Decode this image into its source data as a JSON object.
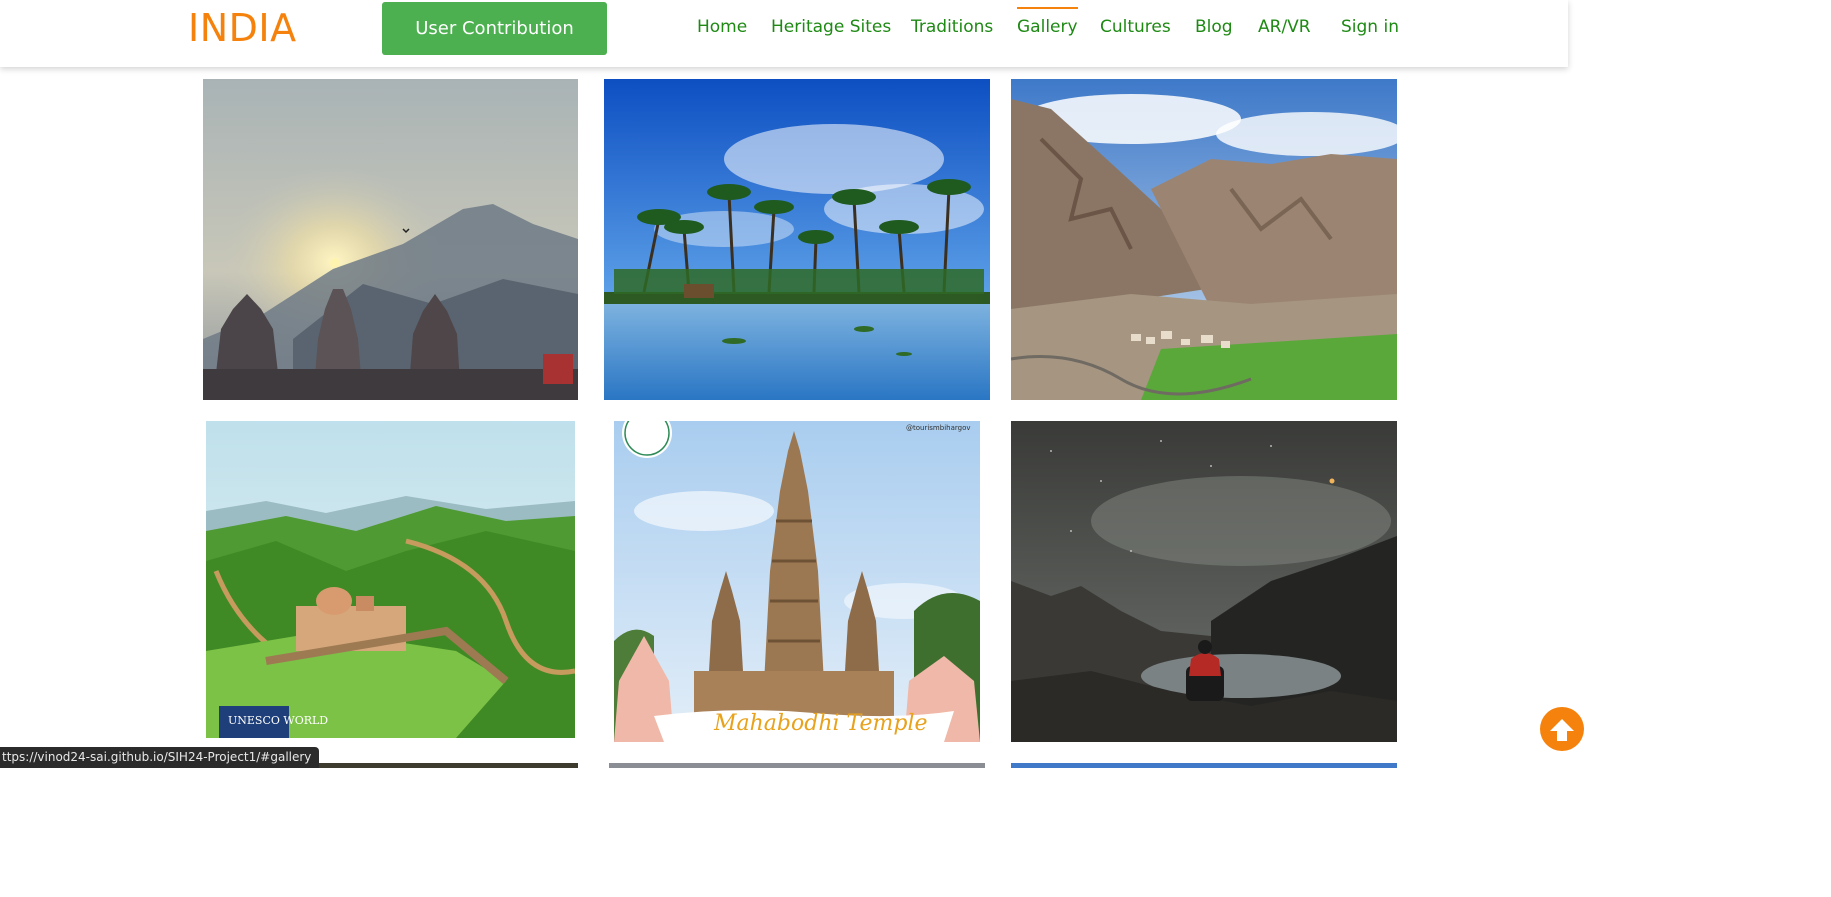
{
  "header": {
    "brand": "INDIA",
    "contribute_label": "User Contribution",
    "nav": [
      {
        "label": "Home",
        "active": false
      },
      {
        "label": "Heritage Sites",
        "active": false
      },
      {
        "label": "Traditions",
        "active": false
      },
      {
        "label": "Gallery",
        "active": true
      },
      {
        "label": "Cultures",
        "active": false
      },
      {
        "label": "Blog",
        "active": false
      },
      {
        "label": "AR/VR",
        "active": false
      },
      {
        "label": "Sign in",
        "active": false
      }
    ]
  },
  "gallery": {
    "images": [
      {
        "subject": "temple towers at sunrise below a mountain"
      },
      {
        "subject": "palm trees on a lagoon under a blue sky"
      },
      {
        "subject": "mountain valley with a village"
      },
      {
        "subject": "hill fort with green hills",
        "badge": "UNESCO WORLD"
      },
      {
        "subject": "Mahabodhi Temple",
        "handle": "@tourismbihargov",
        "logo": "BIHAR TOURISM",
        "caption": "Mahabodhi Temple"
      },
      {
        "subject": "person sitting by a lake under a starry sky"
      }
    ]
  },
  "status_bar": {
    "url": "ttps://vinod24-sai.github.io/SIH24-Project1/#gallery"
  },
  "colors": {
    "brand_orange": "#f5820d",
    "nav_green": "#1e8a14",
    "button_green": "#4caf50"
  },
  "icons": {
    "scroll_top": "arrow-up-icon"
  }
}
